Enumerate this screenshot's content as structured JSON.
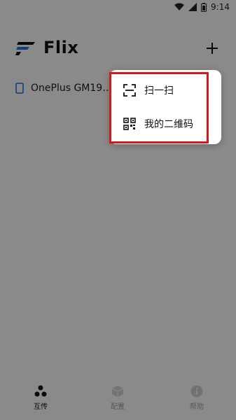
{
  "status": {
    "time": "9:14"
  },
  "app": {
    "title": "Flix",
    "add_icon": "plus-icon"
  },
  "device": {
    "name": "OnePlus GM19…",
    "icon": "phone-icon"
  },
  "menu": {
    "items": [
      {
        "label": "扫一扫",
        "icon": "scan-icon"
      },
      {
        "label": "我的二维码",
        "icon": "qr-code-icon"
      }
    ]
  },
  "tabs": [
    {
      "label": "互传",
      "icon": "transfer-icon",
      "active": true
    },
    {
      "label": "配置",
      "icon": "cube-icon",
      "active": false
    },
    {
      "label": "帮助",
      "icon": "info-icon",
      "active": false
    }
  ],
  "colors": {
    "highlight": "#d11b1b",
    "dim_overlay": "rgba(0,0,0,0.43)",
    "logo_blue": "#1d6fd6"
  }
}
